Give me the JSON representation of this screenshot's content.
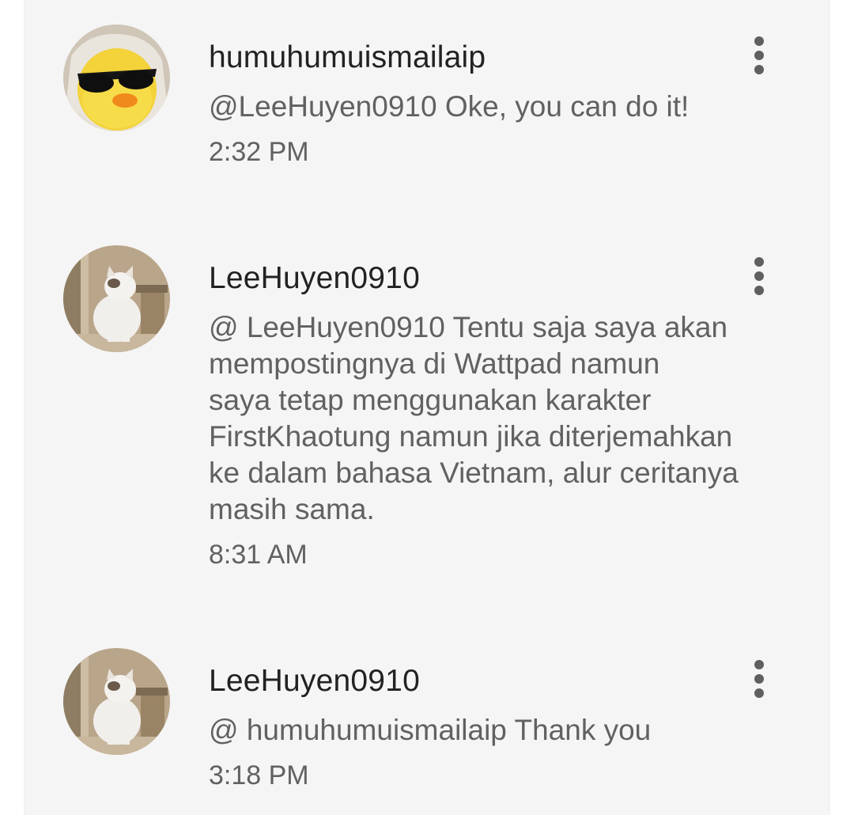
{
  "comments": [
    {
      "username": "humuhumuismailaip",
      "text": "@LeeHuyen0910 Oke, you can do it!",
      "time": "2:32 PM",
      "avatar_icon": "duck-with-sunglasses-avatar"
    },
    {
      "username": "LeeHuyen0910",
      "text": "@ LeeHuyen0910  Tentu saja saya akan\nmempostingnya di Wattpad namun\nsaya tetap menggunakan karakter\nFirstKhaotung namun jika diterjemahkan\nke dalam bahasa Vietnam, alur ceritanya\nmasih sama.",
      "time": "8:31 AM",
      "avatar_icon": "kitten-avatar"
    },
    {
      "username": "LeeHuyen0910",
      "text": "@ humuhumuismailaip Thank you",
      "time": "3:18 PM",
      "avatar_icon": "kitten-avatar"
    }
  ],
  "colors": {
    "card_background": "#f5f5f5",
    "username": "#222222",
    "secondary_text": "#616161",
    "menu_dots": "#5f5f5f"
  }
}
